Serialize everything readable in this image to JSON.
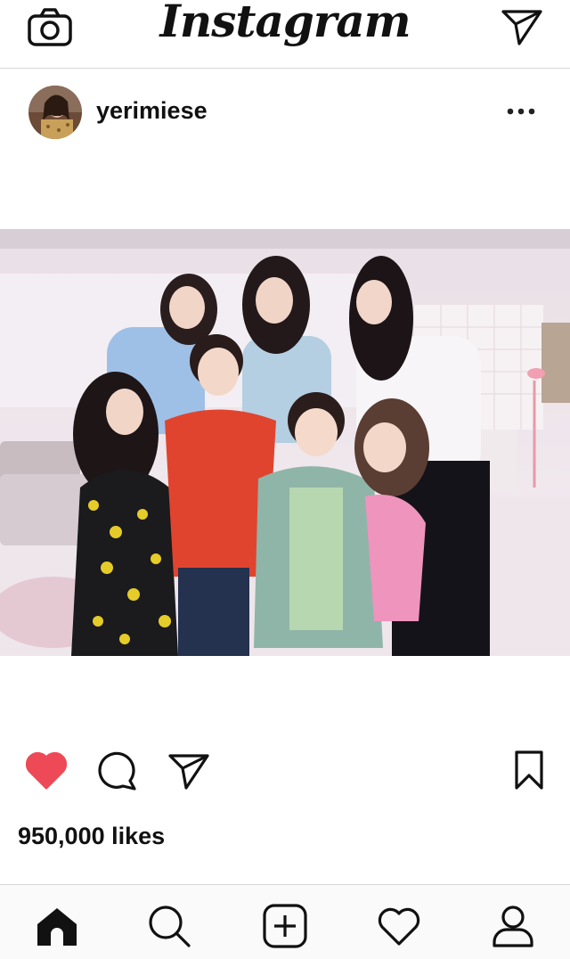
{
  "header": {
    "logo": "Instagram",
    "camera_icon": "camera-icon",
    "direct_icon": "paper-plane-icon"
  },
  "post": {
    "username": "yerimiese",
    "more_icon": "more-horizontal-icon",
    "likes": "950,000 likes",
    "liked": true
  },
  "actions": {
    "like_icon": "heart-filled-icon",
    "comment_icon": "comment-icon",
    "share_icon": "paper-plane-icon",
    "save_icon": "bookmark-icon"
  },
  "tabbar": {
    "items": [
      "home-icon",
      "search-icon",
      "add-post-icon",
      "activity-heart-icon",
      "profile-icon"
    ]
  },
  "colors": {
    "like_red": "#ed4956",
    "divider": "#d6d6d6",
    "text": "#111111"
  }
}
